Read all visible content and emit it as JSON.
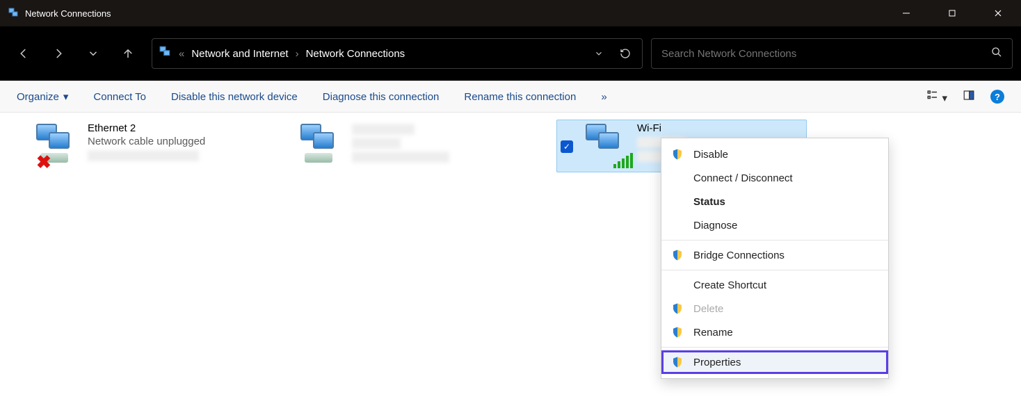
{
  "window": {
    "title": "Network Connections"
  },
  "breadcrumb": {
    "part1": "Network and Internet",
    "part2": "Network Connections"
  },
  "search": {
    "placeholder": "Search Network Connections"
  },
  "commands": {
    "organize": "Organize",
    "connect": "Connect To",
    "disable": "Disable this network device",
    "diagnose": "Diagnose this connection",
    "rename": "Rename this connection",
    "overflow": "»"
  },
  "adapters": [
    {
      "name": "Ethernet 2",
      "status": "Network cable unplugged",
      "selected": false,
      "unplugged": true
    },
    {
      "name": "",
      "status": "",
      "selected": false,
      "unplugged": false
    },
    {
      "name": "Wi-Fi",
      "status": "",
      "selected": true,
      "wifi": true
    }
  ],
  "context_menu": [
    {
      "label": "Disable",
      "shield": true
    },
    {
      "label": "Connect / Disconnect"
    },
    {
      "label": "Status",
      "bold": true
    },
    {
      "label": "Diagnose"
    },
    {
      "sep": true
    },
    {
      "label": "Bridge Connections",
      "shield": true
    },
    {
      "sep": true
    },
    {
      "label": "Create Shortcut"
    },
    {
      "label": "Delete",
      "shield": true,
      "disabled": true
    },
    {
      "label": "Rename",
      "shield": true
    },
    {
      "sep": true
    },
    {
      "label": "Properties",
      "shield": true,
      "highlight": true
    }
  ]
}
